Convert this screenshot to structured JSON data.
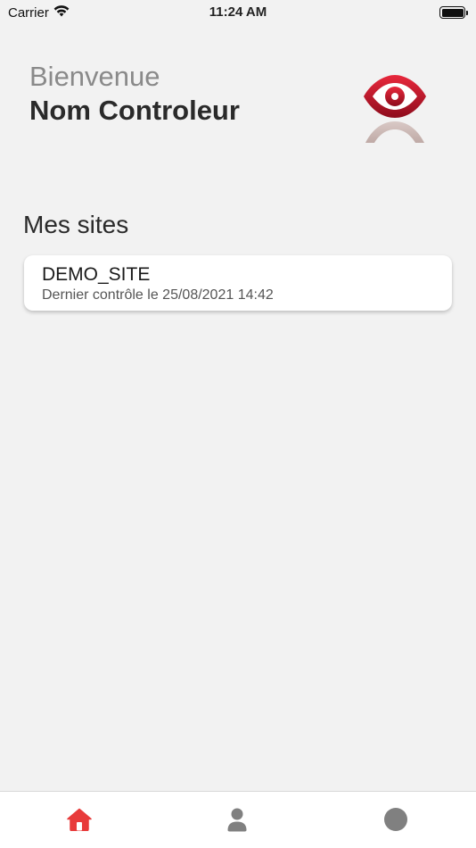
{
  "status_bar": {
    "carrier": "Carrier",
    "time": "11:24 AM"
  },
  "header": {
    "welcome": "Bienvenue",
    "controller_name": "Nom Controleur",
    "logo_icon": "eye-person-logo"
  },
  "sites": {
    "title": "Mes sites",
    "items": [
      {
        "name": "DEMO_SITE",
        "last_check": "Dernier contrôle le 25/08/2021 14:42"
      }
    ]
  },
  "tab_bar": {
    "items": [
      {
        "icon": "home-icon",
        "active": true
      },
      {
        "icon": "user-icon",
        "active": false
      },
      {
        "icon": "circle-icon",
        "active": false
      }
    ]
  },
  "colors": {
    "background": "#f2f2f2",
    "accent": "#e83b3b",
    "logo_red": "#c8102e",
    "tab_inactive": "#808080"
  }
}
